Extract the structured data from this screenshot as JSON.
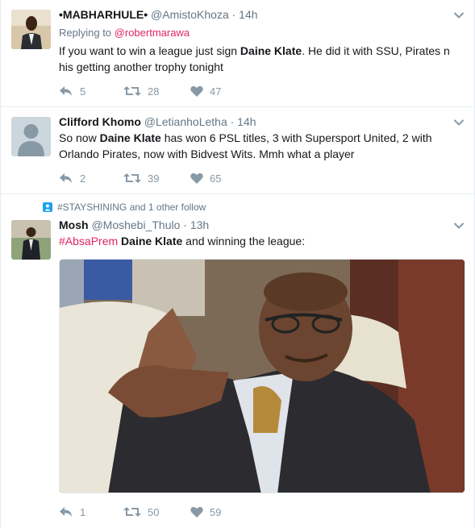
{
  "tweets": [
    {
      "name": "•MABHARHULE•",
      "handle": "@AmistoKhoza",
      "time": "· 14h",
      "replying_prefix": "Replying to",
      "replying_handle": "@robertmarawa",
      "text_1": "If you want to win a league just sign ",
      "bold_1": "Daine Klate",
      "text_2": ". He did it with SSU, Pirates n his getting another trophy tonight",
      "replies": "5",
      "retweets": "28",
      "likes": "47"
    },
    {
      "name": "Clifford Khomo",
      "handle": "@LetianhoLetha",
      "time": "· 14h",
      "text_1": "So now ",
      "bold_1": "Daine Klate",
      "text_2": " has won 6 PSL titles, 3 with Supersport United, 2 with Orlando Pirates, now with Bidvest Wits. Mmh what a player",
      "replies": "2",
      "retweets": "39",
      "likes": "65"
    },
    {
      "social_context": "#STAYSHINING and 1 other follow",
      "name": "Mosh",
      "handle": "@Moshebi_Thulo",
      "time": "· 13h",
      "hashtag": "#AbsaPrem",
      "bold_1": "Daine Klate",
      "text_2": " and winning the league:",
      "replies": "1",
      "retweets": "50",
      "likes": "59"
    }
  ],
  "colors": {
    "text": "#14171a",
    "secondary": "#657786",
    "action_icon": "#8899a6",
    "link": "#e0245e",
    "divider": "#e6ecf0"
  }
}
